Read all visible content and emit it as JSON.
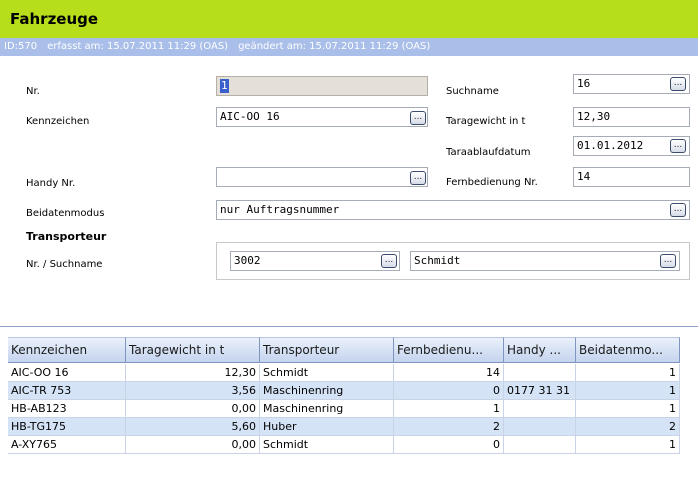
{
  "header": {
    "title": "Fahrzeuge"
  },
  "info": {
    "id": "ID:570",
    "created": "erfasst am: 15.07.2011 11:29 (OAS)",
    "changed": "geändert am: 15.07.2011 11:29 (OAS)"
  },
  "form": {
    "nr_label": "Nr.",
    "nr_value": "1",
    "kennzeichen_label": "Kennzeichen",
    "kennzeichen_value": "AIC-OO 16",
    "handy_label": "Handy Nr.",
    "handy_value": "",
    "beidaten_label": "Beidatenmodus",
    "beidaten_value": "nur Auftragsnummer",
    "suchname_label": "Suchname",
    "suchname_value": "16",
    "taragewicht_label": "Taragewicht in t",
    "taragewicht_value": "12,30",
    "taraablauf_label": "Taraablaufdatum",
    "taraablauf_value": "01.01.2012",
    "fernbedienung_label": "Fernbedienung Nr.",
    "fernbedienung_value": "14",
    "ellipsis": "..."
  },
  "transporteur": {
    "section_label": "Transporteur",
    "nr_label": "Nr. / Suchname",
    "nr_value": "3002",
    "name_value": "Schmidt"
  },
  "grid": {
    "columns": [
      "Kennzeichen",
      "Taragewicht in t",
      "Transporteur",
      "Fernbedienu...",
      "Handy ...",
      "Beidatenmo..."
    ],
    "rows": [
      [
        "AIC-OO 16",
        "12,30",
        "Schmidt",
        "14",
        "",
        "1"
      ],
      [
        "AIC-TR 753",
        "3,56",
        "Maschinenring",
        "0",
        "0177 31 31",
        "1"
      ],
      [
        "HB-AB123",
        "0,00",
        "Maschinenring",
        "1",
        "",
        "1"
      ],
      [
        "HB-TG175",
        "5,60",
        "Huber",
        "2",
        "",
        "2"
      ],
      [
        "A-XY765",
        "0,00",
        "Schmidt",
        "0",
        "",
        "1"
      ]
    ]
  },
  "colors": {
    "title_bar": "#b6de1b",
    "info_bar": "#a9bee8",
    "row_alt": "#d5e3f6"
  }
}
